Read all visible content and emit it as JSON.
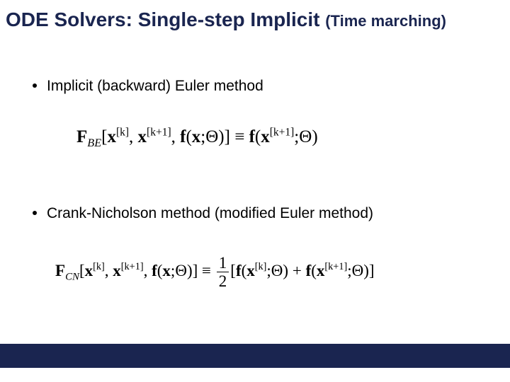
{
  "title": {
    "main": "ODE Solvers: Single-step Implicit ",
    "sub": "(Time marching)"
  },
  "bullets": {
    "b1": "Implicit (backward) Euler method",
    "b2": "Crank-Nicholson method (modified Euler method)"
  },
  "equations": {
    "be": {
      "func": "F",
      "func_sub": "BE",
      "lbr": "[",
      "x": "x",
      "sup_k": "[k]",
      "comma": ", ",
      "sup_k1": "[k+1]",
      "f": "f",
      "lpar": "(",
      "semicolon": ";",
      "theta": "Θ",
      "rpar": ")",
      "rbr": "]",
      "equiv": " ≡ "
    },
    "cn": {
      "func": "F",
      "func_sub": "CN",
      "half_num": "1",
      "half_den": "2",
      "plus": " + "
    }
  }
}
